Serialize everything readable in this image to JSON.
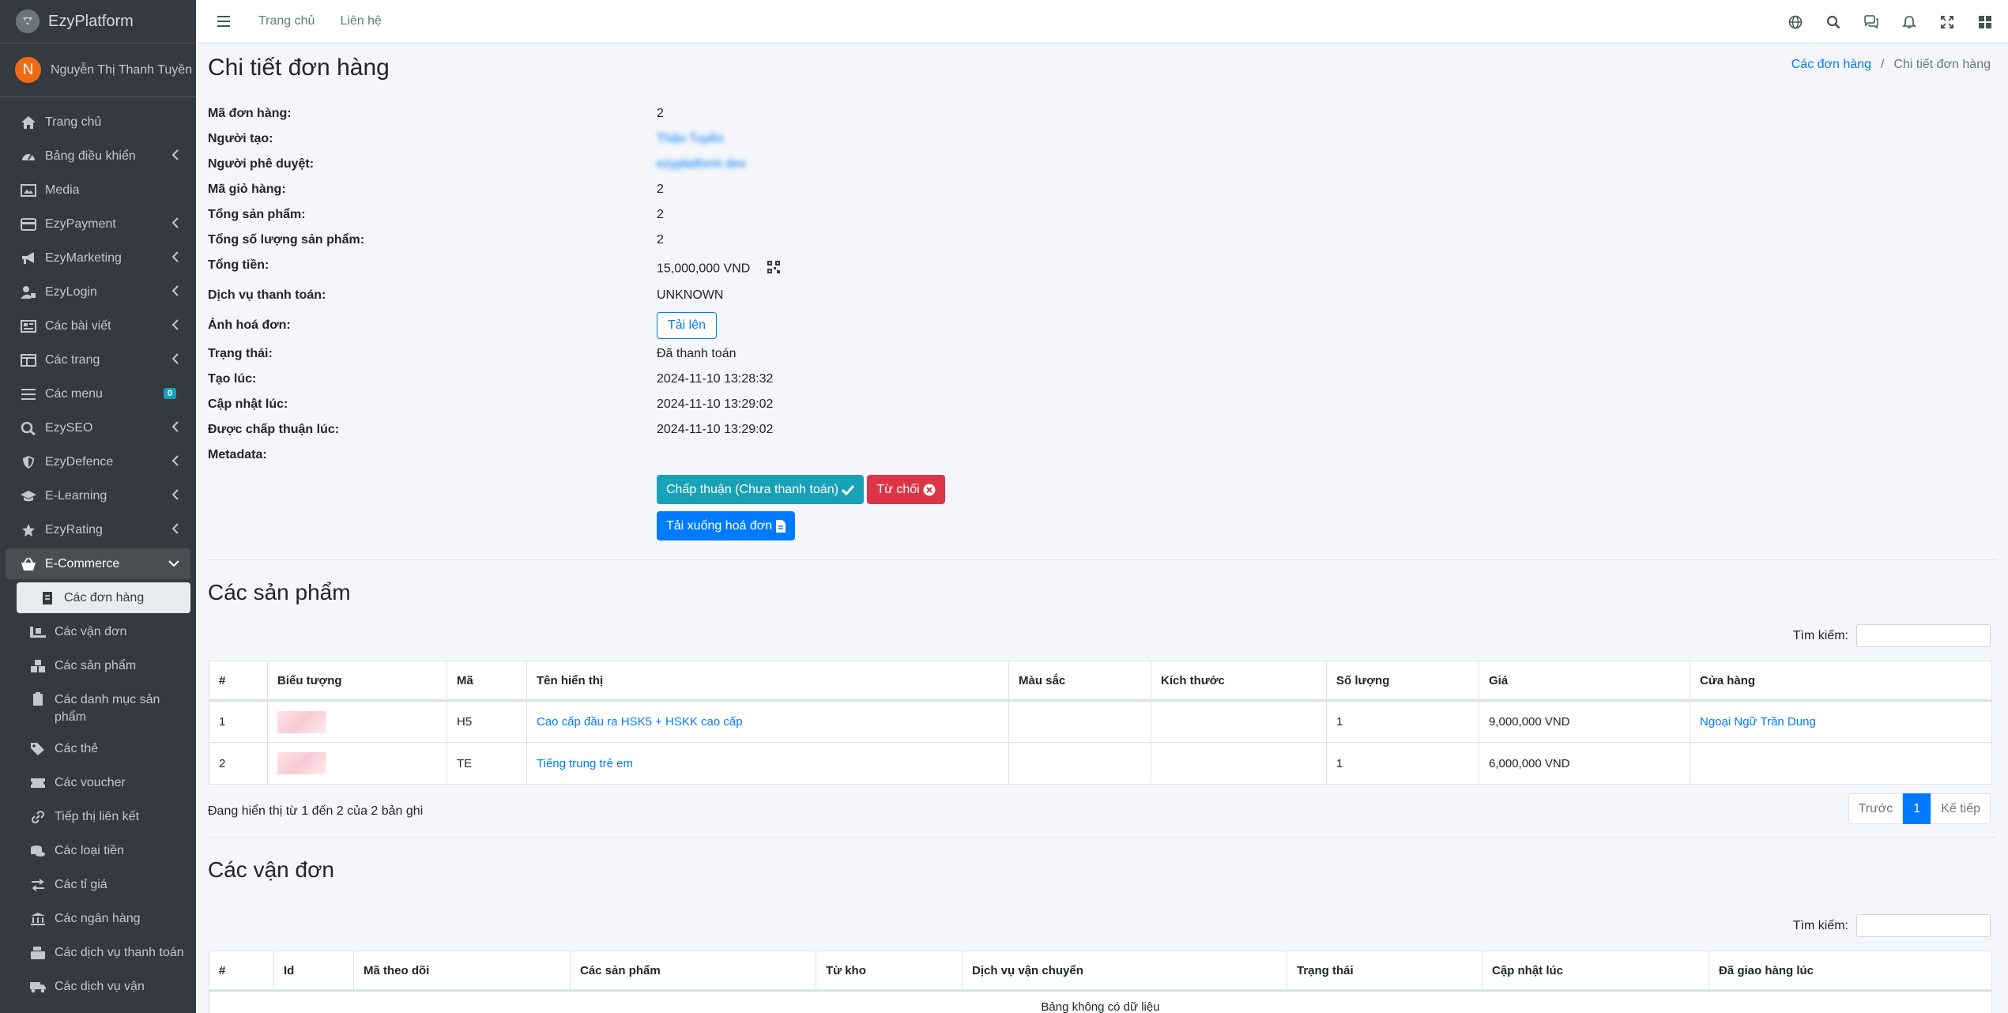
{
  "brand": {
    "name": "EzyPlatform"
  },
  "user": {
    "initial": "N",
    "name": "Nguyễn Thị Thanh Tuyền"
  },
  "sidebar": {
    "items": [
      {
        "label": "Trang chủ",
        "icon": "home-icon"
      },
      {
        "label": "Bảng điều khiển",
        "icon": "dashboard-icon"
      },
      {
        "label": "Media",
        "icon": "image-icon"
      },
      {
        "label": "EzyPayment",
        "icon": "credit-card-icon"
      },
      {
        "label": "EzyMarketing",
        "icon": "megaphone-icon"
      },
      {
        "label": "EzyLogin",
        "icon": "user-lock-icon"
      },
      {
        "label": "Các bài viết",
        "icon": "newspaper-icon"
      },
      {
        "label": "Các trang",
        "icon": "pages-icon"
      },
      {
        "label": "Các menu",
        "icon": "bars-icon",
        "badge": "0"
      },
      {
        "label": "EzySEO",
        "icon": "search-dollar-icon"
      },
      {
        "label": "EzyDefence",
        "icon": "shield-icon"
      },
      {
        "label": "E-Learning",
        "icon": "graduation-cap-icon"
      },
      {
        "label": "EzyRating",
        "icon": "star-icon"
      },
      {
        "label": "E-Commerce",
        "icon": "basket-icon"
      }
    ],
    "sub_items": [
      {
        "label": "Các đơn hàng"
      },
      {
        "label": "Các vận đơn"
      },
      {
        "label": "Các sản phẩm"
      },
      {
        "label": "Các danh mục sản phẩm"
      },
      {
        "label": "Các thẻ"
      },
      {
        "label": "Các voucher"
      },
      {
        "label": "Tiếp thị liên kết"
      },
      {
        "label": "Các loại tiền"
      },
      {
        "label": "Các tỉ giá"
      },
      {
        "label": "Các ngân hàng"
      },
      {
        "label": "Các dịch vụ thanh toán"
      },
      {
        "label": "Các dịch vụ vận"
      }
    ]
  },
  "topbar": {
    "links": [
      "Trang chủ",
      "Liên hệ"
    ]
  },
  "page": {
    "title": "Chi tiết đơn hàng",
    "breadcrumb": {
      "parent": "Các đơn hàng",
      "current": "Chi tiết đơn hàng"
    }
  },
  "order": {
    "fields": [
      {
        "label": "Mã đơn hàng:",
        "value": "2"
      },
      {
        "label": "Người tạo:",
        "value": "Thảo Tuyền"
      },
      {
        "label": "Người phê duyệt:",
        "value": "ezyplatform dev"
      },
      {
        "label": "Mã giỏ hàng:",
        "value": "2"
      },
      {
        "label": "Tổng sản phẩm:",
        "value": "2"
      },
      {
        "label": "Tổng số lượng sản phẩm:",
        "value": "2"
      },
      {
        "label": "Tổng tiền:",
        "value": "15,000,000 VND"
      },
      {
        "label": "Dịch vụ thanh toán:",
        "value": "UNKNOWN"
      },
      {
        "label": "Ảnh hoá đơn:",
        "value": "Tải lên"
      },
      {
        "label": "Trạng thái:",
        "value": "Đã thanh toán"
      },
      {
        "label": "Tạo lúc:",
        "value": "2024-11-10 13:28:32"
      },
      {
        "label": "Cập nhật lúc:",
        "value": "2024-11-10 13:29:02"
      },
      {
        "label": "Được chấp thuận lúc:",
        "value": "2024-11-10 13:29:02"
      },
      {
        "label": "Metadata:",
        "value": ""
      }
    ],
    "buttons": {
      "approve": "Chấp thuận (Chưa thanh toán)",
      "reject": "Từ chối",
      "download": "Tải xuống hoá đơn"
    }
  },
  "products": {
    "title": "Các sản phẩm",
    "search_label": "Tìm kiếm:",
    "columns": [
      "#",
      "Biểu tượng",
      "Mã",
      "Tên hiển thị",
      "Màu sắc",
      "Kích thước",
      "Số lượng",
      "Giá",
      "Cửa hàng"
    ],
    "rows": [
      {
        "no": "1",
        "code": "H5",
        "name": "Cao cấp đầu ra HSK5 + HSKK cao cấp",
        "color": "",
        "size": "",
        "qty": "1",
        "price": "9,000,000 VND",
        "store": "Ngoại Ngữ Trần Dung"
      },
      {
        "no": "2",
        "code": "TE",
        "name": "Tiếng trung trẻ em",
        "color": "",
        "size": "",
        "qty": "1",
        "price": "6,000,000 VND",
        "store": ""
      }
    ],
    "info": "Đang hiển thị từ 1 đến 2 của 2 bản ghi",
    "pager": {
      "prev": "Trước",
      "page": "1",
      "next": "Kế tiếp"
    }
  },
  "shipments": {
    "title": "Các vận đơn",
    "search_label": "Tìm kiếm:",
    "columns": [
      "#",
      "Id",
      "Mã theo dõi",
      "Các sản phẩm",
      "Từ kho",
      "Dịch vụ vận chuyển",
      "Trạng thái",
      "Cập nhật lúc",
      "Đã giao hàng lúc"
    ],
    "empty": "Bảng không có dữ liệu"
  }
}
